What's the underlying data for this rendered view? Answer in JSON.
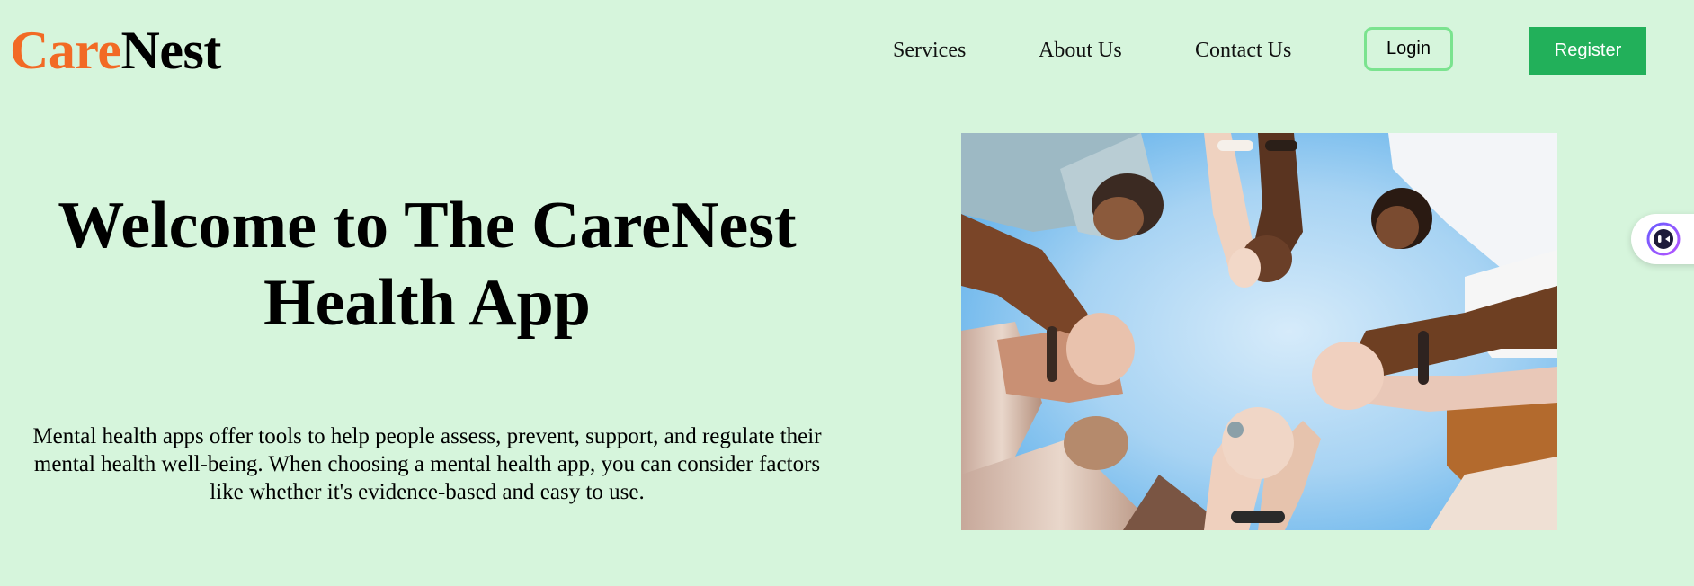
{
  "brand": {
    "name_part1": "Care",
    "name_part2": "Nest"
  },
  "nav": {
    "links": [
      "Services",
      "About Us",
      "Contact Us"
    ],
    "login_label": "Login",
    "register_label": "Register"
  },
  "hero": {
    "title": "Welcome to The CareNest Health App",
    "description": "Mental health apps offer tools to help people assess, prevent, support, and regulate their mental health well-being. When choosing a mental health app, you can consider factors like whether it's evidence-based and easy to use."
  },
  "icons": {
    "chat": "chat-assistant-icon"
  },
  "colors": {
    "background": "#d6f5dc",
    "brand_accent": "#f26a25",
    "register_button": "#22b05a",
    "login_border": "#7be38f"
  }
}
